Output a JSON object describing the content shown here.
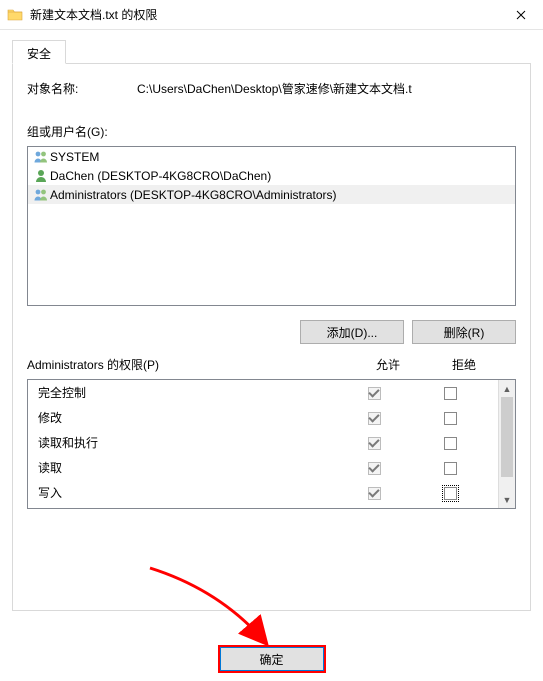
{
  "window": {
    "title": "新建文本文档.txt 的权限"
  },
  "tab": {
    "label": "安全"
  },
  "object": {
    "label": "对象名称:",
    "value": "C:\\Users\\DaChen\\Desktop\\管家速修\\新建文本文档.t"
  },
  "groups": {
    "label": "组或用户名(G):",
    "items": [
      {
        "name": "SYSTEM",
        "icon": "group",
        "selected": false
      },
      {
        "name": "DaChen (DESKTOP-4KG8CRO\\DaChen)",
        "icon": "user",
        "selected": false
      },
      {
        "name": "Administrators (DESKTOP-4KG8CRO\\Administrators)",
        "icon": "group",
        "selected": true
      }
    ]
  },
  "buttons": {
    "add": "添加(D)...",
    "remove": "删除(R)"
  },
  "permissions": {
    "title": "Administrators 的权限(P)",
    "col_allow": "允许",
    "col_deny": "拒绝",
    "rows": [
      {
        "name": "完全控制",
        "allow": true,
        "deny": false
      },
      {
        "name": "修改",
        "allow": true,
        "deny": false
      },
      {
        "name": "读取和执行",
        "allow": true,
        "deny": false
      },
      {
        "name": "读取",
        "allow": true,
        "deny": false
      },
      {
        "name": "写入",
        "allow": true,
        "deny": false
      }
    ]
  },
  "footer": {
    "ok": "确定"
  }
}
